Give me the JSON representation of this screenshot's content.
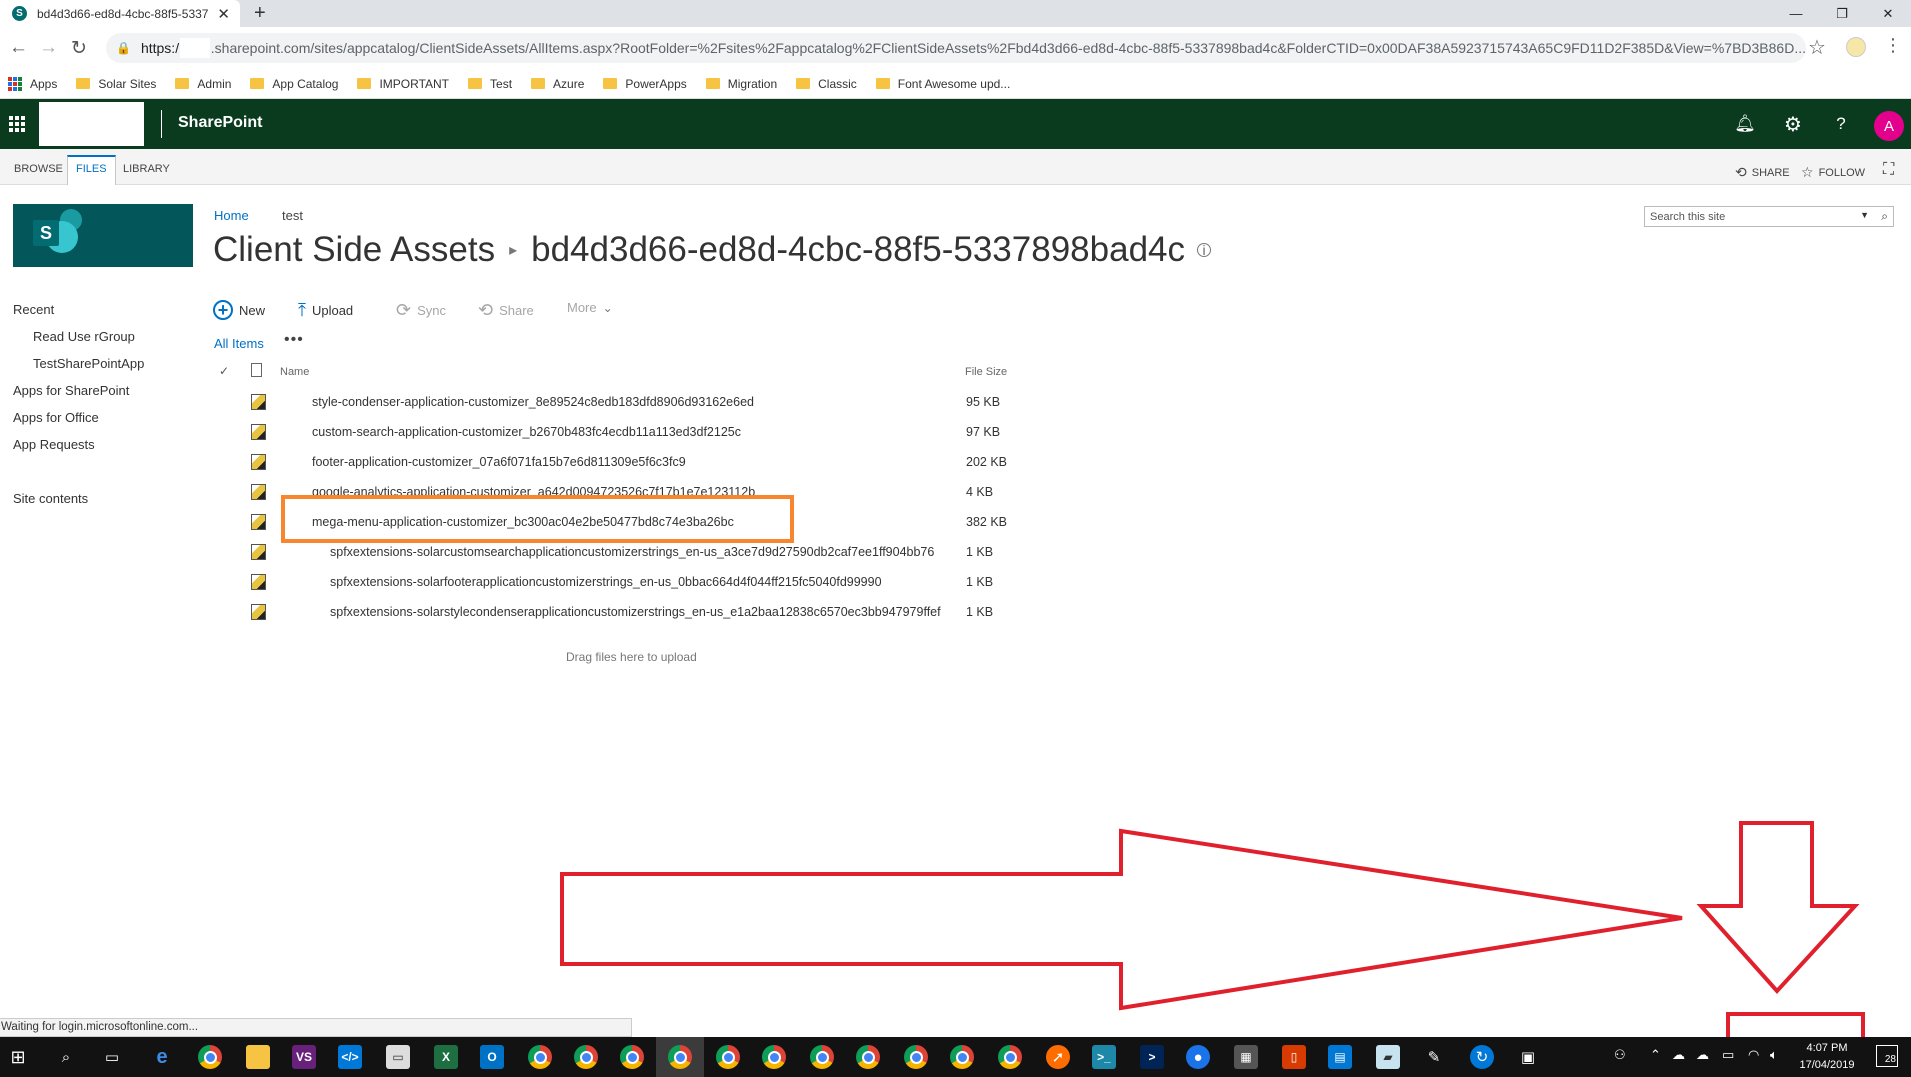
{
  "browser": {
    "tab_title": "bd4d3d66-ed8d-4cbc-88f5-5337",
    "tab_close": "✕",
    "new_tab": "+",
    "url_scheme": "https:/",
    "url_rest": ".sharepoint.com/sites/appcatalog/ClientSideAssets/AllItems.aspx?RootFolder=%2Fsites%2Fappcatalog%2FClientSideAssets%2Fbd4d3d66-ed8d-4cbc-88f5-5337898bad4c&FolderCTID=0x00DAF38A5923715743A65C9FD11D2F385D&View=%7BD3B86D...",
    "bookmarks": [
      "Apps",
      "Solar Sites",
      "Admin",
      "App Catalog",
      "IMPORTANT",
      "Test",
      "Azure",
      "PowerApps",
      "Migration",
      "Classic",
      "Font Awesome upd..."
    ]
  },
  "suite": {
    "title": "SharePoint",
    "avatar_initial": "A",
    "icons": [
      "bell-icon",
      "gear-icon",
      "help-icon"
    ]
  },
  "ribbon": {
    "tabs": [
      "BROWSE",
      "FILES",
      "LIBRARY"
    ],
    "active_tab": "FILES",
    "share": "SHARE",
    "follow": "FOLLOW"
  },
  "left_nav": {
    "recent": "Recent",
    "recent_items": [
      "Read Use rGroup",
      "TestSharePointApp"
    ],
    "items": [
      "Apps for SharePoint",
      "Apps for Office",
      "App Requests"
    ],
    "site_contents": "Site contents"
  },
  "header": {
    "breadcrumb": [
      "Home",
      "test"
    ],
    "title_library": "Client Side Assets",
    "title_folder": "bd4d3d66-ed8d-4cbc-88f5-5337898bad4c",
    "search_placeholder": "Search this site"
  },
  "commands": {
    "new": "New",
    "upload": "Upload",
    "sync": "Sync",
    "share": "Share",
    "more": "More",
    "view": "All Items",
    "view_options": "•••"
  },
  "list": {
    "col_name": "Name",
    "col_size": "File Size",
    "rows": [
      {
        "name": "style-condenser-application-customizer_8e89524c8edb183dfd8906d93162e6ed",
        "size": "95 KB"
      },
      {
        "name": "custom-search-application-customizer_b2670b483fc4ecdb11a113ed3df2125c",
        "size": "97 KB"
      },
      {
        "name": "footer-application-customizer_07a6f071fa15b7e6d811309e5f6c3fc9",
        "size": "202 KB"
      },
      {
        "name": "google-analytics-application-customizer_a642d0094723526c7f17b1e7e123112b",
        "size": "4 KB"
      },
      {
        "name": "mega-menu-application-customizer_bc300ac04e2be50477bd8c74e3ba26bc",
        "size": "382 KB"
      },
      {
        "name": "spfxextensions-solarcustomsearchapplicationcustomizerstrings_en-us_a3ce7d9d27590db2caf7ee1ff904bb76",
        "size": "1 KB"
      },
      {
        "name": "spfxextensions-solarfooterapplicationcustomizerstrings_en-us_0bbac664d4f044ff215fc5040fd99990",
        "size": "1 KB"
      },
      {
        "name": "spfxextensions-solarstylecondenserapplicationcustomizerstrings_en-us_e1a2baa12838c6570ec3bb947979ffef",
        "size": "1 KB"
      }
    ],
    "drag_hint": "Drag files here to upload"
  },
  "status_text": "Waiting for login.microsoftonline.com...",
  "taskbar": {
    "time": "4:07 PM",
    "date": "17/04/2019",
    "notification_count": "28"
  },
  "colors": {
    "suite_bar": "#0a3b1f",
    "accent": "#0072c6",
    "highlight_box": "#f7862e",
    "annotation": "#e0202c"
  }
}
